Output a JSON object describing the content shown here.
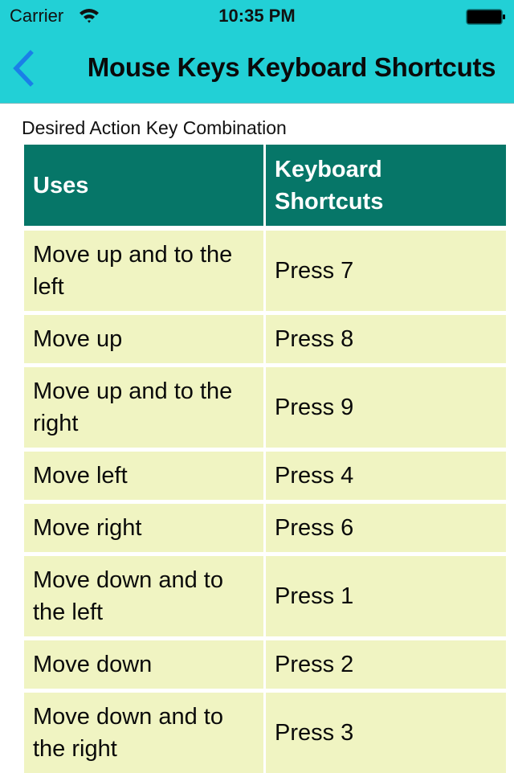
{
  "status_bar": {
    "carrier": "Carrier",
    "time": "10:35 PM",
    "wifi_icon": "wifi-icon",
    "battery_icon": "battery-full-icon"
  },
  "nav": {
    "back_icon": "chevron-left-icon",
    "title": "Mouse Keys Keyboard Shortcuts",
    "accent_color": "#1a7fe8",
    "background_color": "#22d0d6"
  },
  "caption": "Desired Action Key Combination",
  "table": {
    "header_color": "#067668",
    "row_color": "#f0f4c2",
    "headers": [
      "Uses",
      "Keyboard Shortcuts"
    ],
    "rows": [
      {
        "use": "Move up and to the left",
        "shortcut": "Press 7"
      },
      {
        "use": "Move up",
        "shortcut": "Press 8"
      },
      {
        "use": "Move up and to the right",
        "shortcut": "Press 9"
      },
      {
        "use": "Move left",
        "shortcut": "Press 4"
      },
      {
        "use": "Move right",
        "shortcut": "Press 6"
      },
      {
        "use": "Move down and to the left",
        "shortcut": "Press 1"
      },
      {
        "use": "Move down",
        "shortcut": "Press 2"
      },
      {
        "use": "Move down and to the right",
        "shortcut": "Press 3"
      }
    ]
  }
}
